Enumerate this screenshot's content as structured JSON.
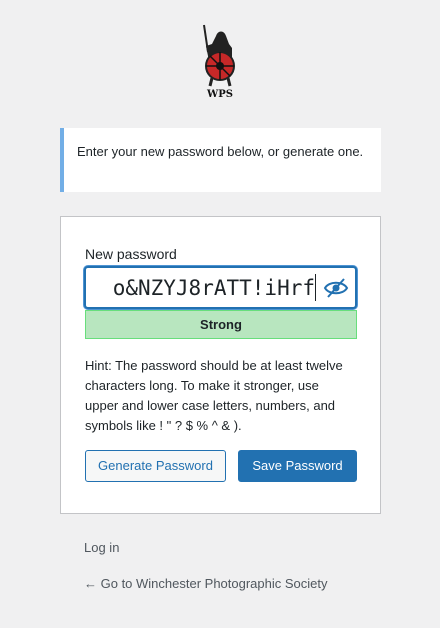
{
  "logo": {
    "text": "WPS",
    "icon": "society-logo-icon"
  },
  "message": {
    "text": "Enter your new password below, or generate one."
  },
  "form": {
    "new_password_label": "New password",
    "password_value": "o&NZYJ8rATT!iHrf",
    "toggle_icon": "eye-slash-icon",
    "strength": "Strong",
    "hint": "Hint: The password should be at least twelve characters long. To make it stronger, use upper and lower case letters, numbers, and symbols like ! \" ? $ % ^ & ).",
    "generate_label": "Generate Password",
    "save_label": "Save Password"
  },
  "links": {
    "login": "Log in",
    "back": "← Go to Winchester Photographic Society"
  },
  "colors": {
    "accent": "#2271b1",
    "notice_border": "#72aee6",
    "strength_bg": "#b8e6bf",
    "logo_red": "#c62828"
  }
}
